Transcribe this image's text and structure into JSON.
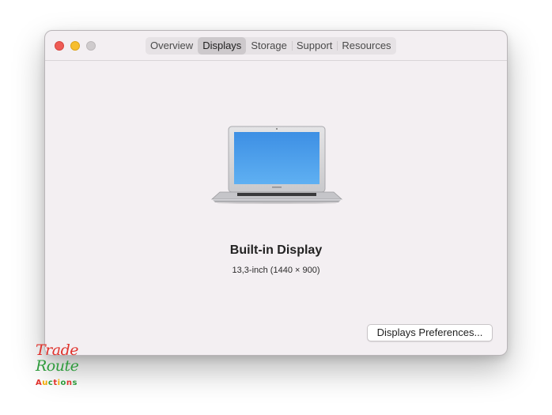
{
  "window": {
    "tabs": [
      {
        "label": "Overview",
        "active": false
      },
      {
        "label": "Displays",
        "active": true
      },
      {
        "label": "Storage",
        "active": false
      },
      {
        "label": "Support",
        "active": false
      },
      {
        "label": "Resources",
        "active": false
      }
    ]
  },
  "display": {
    "name": "Built-in Display",
    "spec": "13,3-inch (1440 × 900)"
  },
  "buttons": {
    "preferences_label": "Displays Preferences..."
  },
  "icons": {
    "laptop": "laptop-icon"
  },
  "watermark": {
    "line1": "Trade",
    "line2": "Route",
    "line3": "Auctions"
  },
  "colors": {
    "close": "#ee5b55",
    "minimize": "#f7be2e",
    "zoom": "#cfcbcd",
    "screen": "#3d94e8"
  }
}
